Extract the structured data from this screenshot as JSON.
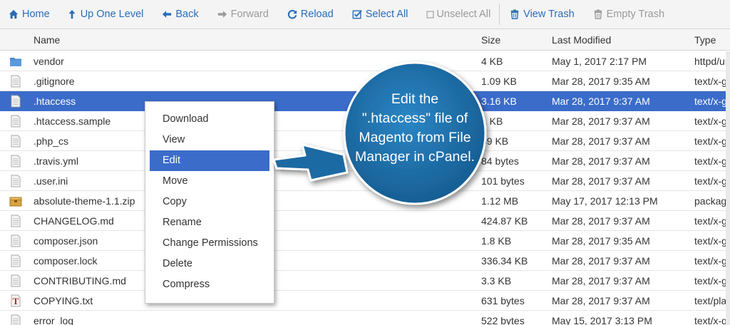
{
  "toolbar": {
    "home": "Home",
    "up_one_level": "Up One Level",
    "back": "Back",
    "forward": "Forward",
    "reload": "Reload",
    "select_all": "Select All",
    "unselect_all": "Unselect All",
    "view_trash": "View Trash",
    "empty_trash": "Empty Trash"
  },
  "columns": {
    "name": "Name",
    "size": "Size",
    "modified": "Last Modified",
    "type": "Type"
  },
  "files": [
    {
      "name": "vendor",
      "size": "4 KB",
      "modified": "May 1, 2017 2:17 PM",
      "type": "httpd/un",
      "icon": "folder-icon"
    },
    {
      "name": ".gitignore",
      "size": "1.09 KB",
      "modified": "Mar 28, 2017 9:35 AM",
      "type": "text/x-g",
      "icon": "file-icon"
    },
    {
      "name": ".htaccess",
      "size": "3.16 KB",
      "modified": "Mar 28, 2017 9:37 AM",
      "type": "text/x-g",
      "icon": "file-icon"
    },
    {
      "name": ".htaccess.sample",
      "size": "1 KB",
      "modified": "Mar 28, 2017 9:37 AM",
      "type": "text/x-g",
      "icon": "file-icon"
    },
    {
      "name": ".php_cs",
      "size": "59 KB",
      "modified": "Mar 28, 2017 9:37 AM",
      "type": "text/x-g",
      "icon": "file-icon"
    },
    {
      "name": ".travis.yml",
      "size": "84 bytes",
      "modified": "Mar 28, 2017 9:37 AM",
      "type": "text/x-g",
      "icon": "file-icon"
    },
    {
      "name": ".user.ini",
      "size": "101 bytes",
      "modified": "Mar 28, 2017 9:37 AM",
      "type": "text/x-g",
      "icon": "file-icon"
    },
    {
      "name": "absolute-theme-1.1.zip",
      "size": "1.12 MB",
      "modified": "May 17, 2017 12:13 PM",
      "type": "package",
      "icon": "archive-icon"
    },
    {
      "name": "CHANGELOG.md",
      "size": "424.87 KB",
      "modified": "Mar 28, 2017 9:37 AM",
      "type": "text/x-g",
      "icon": "file-icon"
    },
    {
      "name": "composer.json",
      "size": "1.8 KB",
      "modified": "Mar 28, 2017 9:35 AM",
      "type": "text/x-g",
      "icon": "file-icon"
    },
    {
      "name": "composer.lock",
      "size": "336.34 KB",
      "modified": "Mar 28, 2017 9:37 AM",
      "type": "text/x-g",
      "icon": "file-icon"
    },
    {
      "name": "CONTRIBUTING.md",
      "size": "3.3 KB",
      "modified": "Mar 28, 2017 9:37 AM",
      "type": "text/x-g",
      "icon": "file-icon"
    },
    {
      "name": "COPYING.txt",
      "size": "631 bytes",
      "modified": "Mar 28, 2017 9:37 AM",
      "type": "text/plai",
      "icon": "text-file-icon"
    },
    {
      "name": "error_log",
      "size": "522 bytes",
      "modified": "May 15, 2017 3:13 PM",
      "type": "text/x-g",
      "icon": "file-icon"
    }
  ],
  "selected_index": 2,
  "context_menu": {
    "items": [
      "Download",
      "View",
      "Edit",
      "Move",
      "Copy",
      "Rename",
      "Change Permissions",
      "Delete",
      "Compress"
    ],
    "active_index": 2
  },
  "callout": {
    "lines": [
      "Edit the",
      "\".htaccess\" file of",
      "Magento from File",
      "Manager in cPanel."
    ],
    "color": "#1f6fa8"
  },
  "colors": {
    "accent": "#2a6db8",
    "selection": "#3b6cc9"
  }
}
